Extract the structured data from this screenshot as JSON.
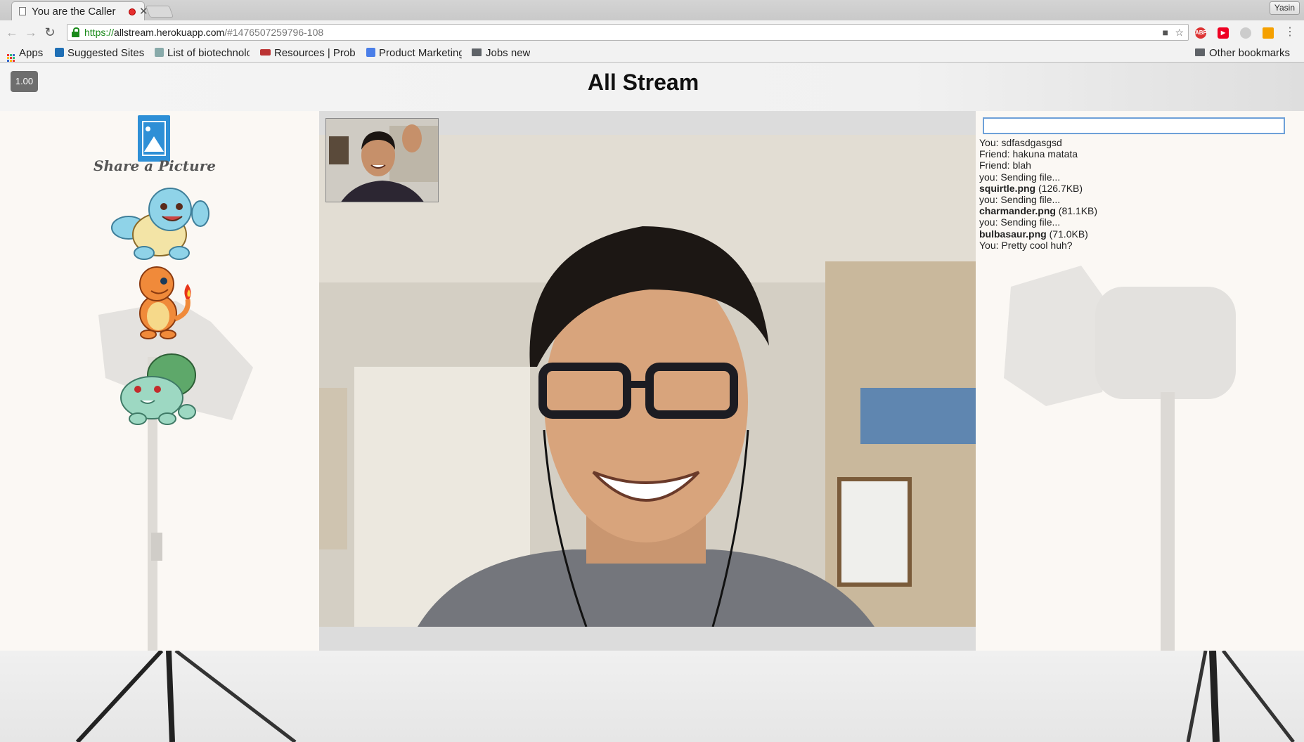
{
  "browser": {
    "tab_title": "You are the Caller",
    "url_scheme": "https://",
    "url_host": "allstream.herokuapp.com",
    "url_path": "/#1476507259796-108",
    "profile_name": "Yasin",
    "bookmarks": [
      {
        "label": "Apps",
        "icon": "apps-grid-icon"
      },
      {
        "label": "Suggested Sites",
        "icon": "bing-icon"
      },
      {
        "label": "List of biotechnology",
        "icon": "doc-icon"
      },
      {
        "label": "Resources | Problems",
        "icon": "edx-icon"
      },
      {
        "label": "Product Marketing",
        "icon": "google-icon"
      },
      {
        "label": "Jobs new",
        "icon": "folder-icon"
      }
    ],
    "other_bookmarks": "Other bookmarks",
    "extensions": [
      "abp-icon",
      "youtube-icon",
      "extension-icon",
      "slides-icon"
    ]
  },
  "page": {
    "speed_badge": "1.00",
    "title": "All Stream",
    "share_label": "Share a Picture",
    "pokemon": [
      "squirtle",
      "charmander",
      "bulbasaur"
    ]
  },
  "chat": {
    "input_value": "",
    "messages": [
      {
        "prefix": "You: ",
        "text": "sdfasdgasgsd",
        "bold": ""
      },
      {
        "prefix": "Friend: ",
        "text": "hakuna matata",
        "bold": ""
      },
      {
        "prefix": "Friend: ",
        "text": "blah",
        "bold": ""
      },
      {
        "prefix": "you: ",
        "text": "Sending file...",
        "bold": ""
      },
      {
        "prefix": "",
        "text": " (126.7KB)",
        "bold": "squirtle.png"
      },
      {
        "prefix": "you: ",
        "text": "Sending file...",
        "bold": ""
      },
      {
        "prefix": "",
        "text": " (81.1KB)",
        "bold": "charmander.png"
      },
      {
        "prefix": "you: ",
        "text": "Sending file...",
        "bold": ""
      },
      {
        "prefix": "",
        "text": " (71.0KB)",
        "bold": "bulbasaur.png"
      },
      {
        "prefix": "You: ",
        "text": "Pretty cool huh?",
        "bold": ""
      }
    ]
  },
  "colors": {
    "accent_blue": "#2e8fd6",
    "secure_green": "#1a8a1a"
  }
}
